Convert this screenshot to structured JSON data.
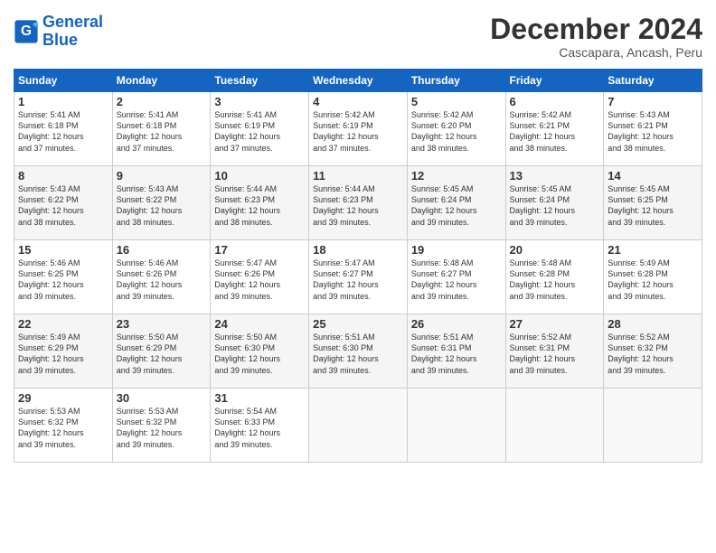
{
  "logo": {
    "line1": "General",
    "line2": "Blue"
  },
  "title": "December 2024",
  "subtitle": "Cascapara, Ancash, Peru",
  "days_header": [
    "Sunday",
    "Monday",
    "Tuesday",
    "Wednesday",
    "Thursday",
    "Friday",
    "Saturday"
  ],
  "weeks": [
    [
      {
        "day": "1",
        "info": "Sunrise: 5:41 AM\nSunset: 6:18 PM\nDaylight: 12 hours\nand 37 minutes."
      },
      {
        "day": "2",
        "info": "Sunrise: 5:41 AM\nSunset: 6:18 PM\nDaylight: 12 hours\nand 37 minutes."
      },
      {
        "day": "3",
        "info": "Sunrise: 5:41 AM\nSunset: 6:19 PM\nDaylight: 12 hours\nand 37 minutes."
      },
      {
        "day": "4",
        "info": "Sunrise: 5:42 AM\nSunset: 6:19 PM\nDaylight: 12 hours\nand 37 minutes."
      },
      {
        "day": "5",
        "info": "Sunrise: 5:42 AM\nSunset: 6:20 PM\nDaylight: 12 hours\nand 38 minutes."
      },
      {
        "day": "6",
        "info": "Sunrise: 5:42 AM\nSunset: 6:21 PM\nDaylight: 12 hours\nand 38 minutes."
      },
      {
        "day": "7",
        "info": "Sunrise: 5:43 AM\nSunset: 6:21 PM\nDaylight: 12 hours\nand 38 minutes."
      }
    ],
    [
      {
        "day": "8",
        "info": "Sunrise: 5:43 AM\nSunset: 6:22 PM\nDaylight: 12 hours\nand 38 minutes."
      },
      {
        "day": "9",
        "info": "Sunrise: 5:43 AM\nSunset: 6:22 PM\nDaylight: 12 hours\nand 38 minutes."
      },
      {
        "day": "10",
        "info": "Sunrise: 5:44 AM\nSunset: 6:23 PM\nDaylight: 12 hours\nand 38 minutes."
      },
      {
        "day": "11",
        "info": "Sunrise: 5:44 AM\nSunset: 6:23 PM\nDaylight: 12 hours\nand 39 minutes."
      },
      {
        "day": "12",
        "info": "Sunrise: 5:45 AM\nSunset: 6:24 PM\nDaylight: 12 hours\nand 39 minutes."
      },
      {
        "day": "13",
        "info": "Sunrise: 5:45 AM\nSunset: 6:24 PM\nDaylight: 12 hours\nand 39 minutes."
      },
      {
        "day": "14",
        "info": "Sunrise: 5:45 AM\nSunset: 6:25 PM\nDaylight: 12 hours\nand 39 minutes."
      }
    ],
    [
      {
        "day": "15",
        "info": "Sunrise: 5:46 AM\nSunset: 6:25 PM\nDaylight: 12 hours\nand 39 minutes."
      },
      {
        "day": "16",
        "info": "Sunrise: 5:46 AM\nSunset: 6:26 PM\nDaylight: 12 hours\nand 39 minutes."
      },
      {
        "day": "17",
        "info": "Sunrise: 5:47 AM\nSunset: 6:26 PM\nDaylight: 12 hours\nand 39 minutes."
      },
      {
        "day": "18",
        "info": "Sunrise: 5:47 AM\nSunset: 6:27 PM\nDaylight: 12 hours\nand 39 minutes."
      },
      {
        "day": "19",
        "info": "Sunrise: 5:48 AM\nSunset: 6:27 PM\nDaylight: 12 hours\nand 39 minutes."
      },
      {
        "day": "20",
        "info": "Sunrise: 5:48 AM\nSunset: 6:28 PM\nDaylight: 12 hours\nand 39 minutes."
      },
      {
        "day": "21",
        "info": "Sunrise: 5:49 AM\nSunset: 6:28 PM\nDaylight: 12 hours\nand 39 minutes."
      }
    ],
    [
      {
        "day": "22",
        "info": "Sunrise: 5:49 AM\nSunset: 6:29 PM\nDaylight: 12 hours\nand 39 minutes."
      },
      {
        "day": "23",
        "info": "Sunrise: 5:50 AM\nSunset: 6:29 PM\nDaylight: 12 hours\nand 39 minutes."
      },
      {
        "day": "24",
        "info": "Sunrise: 5:50 AM\nSunset: 6:30 PM\nDaylight: 12 hours\nand 39 minutes."
      },
      {
        "day": "25",
        "info": "Sunrise: 5:51 AM\nSunset: 6:30 PM\nDaylight: 12 hours\nand 39 minutes."
      },
      {
        "day": "26",
        "info": "Sunrise: 5:51 AM\nSunset: 6:31 PM\nDaylight: 12 hours\nand 39 minutes."
      },
      {
        "day": "27",
        "info": "Sunrise: 5:52 AM\nSunset: 6:31 PM\nDaylight: 12 hours\nand 39 minutes."
      },
      {
        "day": "28",
        "info": "Sunrise: 5:52 AM\nSunset: 6:32 PM\nDaylight: 12 hours\nand 39 minutes."
      }
    ],
    [
      {
        "day": "29",
        "info": "Sunrise: 5:53 AM\nSunset: 6:32 PM\nDaylight: 12 hours\nand 39 minutes."
      },
      {
        "day": "30",
        "info": "Sunrise: 5:53 AM\nSunset: 6:32 PM\nDaylight: 12 hours\nand 39 minutes."
      },
      {
        "day": "31",
        "info": "Sunrise: 5:54 AM\nSunset: 6:33 PM\nDaylight: 12 hours\nand 39 minutes."
      },
      {
        "day": "",
        "info": ""
      },
      {
        "day": "",
        "info": ""
      },
      {
        "day": "",
        "info": ""
      },
      {
        "day": "",
        "info": ""
      }
    ]
  ]
}
